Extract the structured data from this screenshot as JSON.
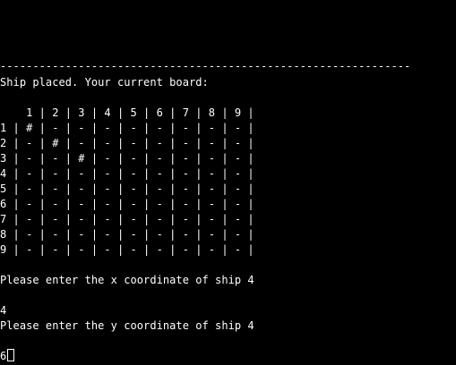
{
  "terminal": {
    "separator": "---------------------------------------------------------------",
    "status_message": "Ship placed. Your current board:",
    "board": {
      "header": "    1 | 2 | 3 | 4 | 5 | 6 | 7 | 8 | 9 |",
      "rows": [
        "1 | # | - | - | - | - | - | - | - | - |",
        "2 | - | # | - | - | - | - | - | - | - |",
        "3 | - | - | # | - | - | - | - | - | - |",
        "4 | - | - | - | - | - | - | - | - | - |",
        "5 | - | - | - | - | - | - | - | - | - |",
        "6 | - | - | - | - | - | - | - | - | - |",
        "7 | - | - | - | - | - | - | - | - | - |",
        "8 | - | - | - | - | - | - | - | - | - |",
        "9 | - | - | - | - | - | - | - | - | - |"
      ]
    },
    "prompt_x": "Please enter the x coordinate of ship 4",
    "input_x": "4",
    "prompt_y": "Please enter the y coordinate of ship 4",
    "current_input": "6"
  },
  "colors": {
    "background": "#000000",
    "text": "#ffffff"
  }
}
